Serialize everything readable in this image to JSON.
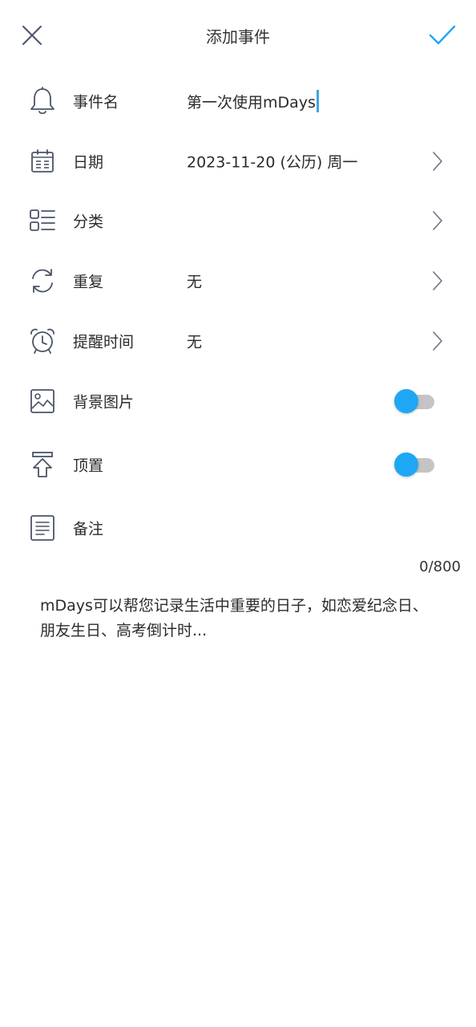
{
  "header": {
    "title": "添加事件",
    "close_icon": "close-icon",
    "confirm_icon": "check-icon"
  },
  "form": {
    "event_name": {
      "icon": "bell-icon",
      "label": "事件名",
      "value": "第一次使用mDays"
    },
    "date": {
      "icon": "calendar-icon",
      "label": "日期",
      "value": "2023-11-20 (公历) 周一"
    },
    "category": {
      "icon": "category-list-icon",
      "label": "分类",
      "value": ""
    },
    "repeat": {
      "icon": "repeat-icon",
      "label": "重复",
      "value": "无"
    },
    "reminder": {
      "icon": "alarm-clock-icon",
      "label": "提醒时间",
      "value": "无"
    },
    "background_image": {
      "icon": "image-icon",
      "label": "背景图片",
      "enabled": false
    },
    "pin_top": {
      "icon": "pin-top-icon",
      "label": "顶置",
      "enabled": false
    },
    "note": {
      "icon": "note-icon",
      "label": "备注",
      "counter": "0/800",
      "placeholder": "mDays可以帮您记录生活中重要的日子，如恋爱纪念日、朋友生日、高考倒计时..."
    }
  },
  "colors": {
    "accent": "#1ea7f5",
    "toggle_track_off": "#c4c4c4",
    "icon_stroke": "#4a5468",
    "cursor": "#3aa7e0"
  }
}
